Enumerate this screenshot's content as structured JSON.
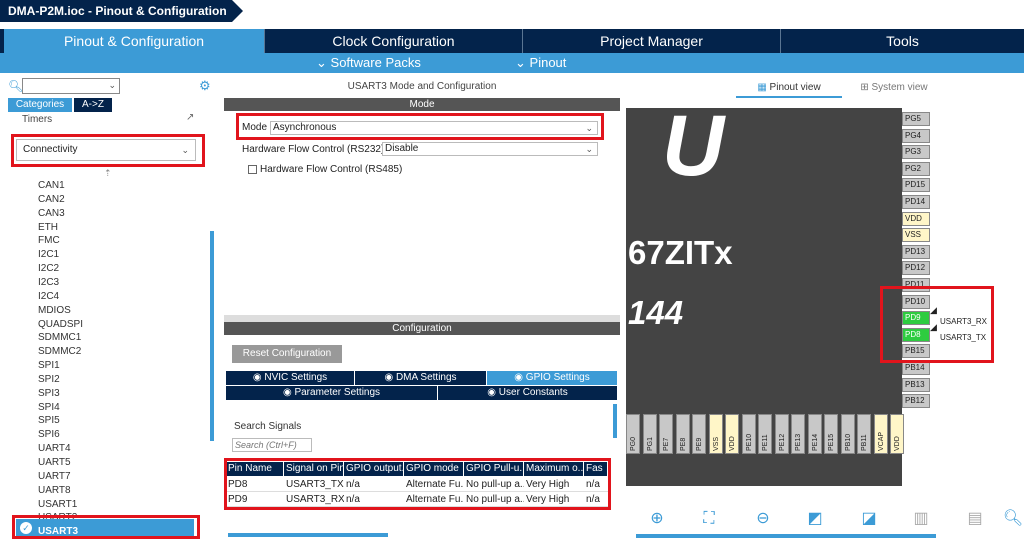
{
  "title": "DMA-P2M.ioc - Pinout & Configuration",
  "tabs": [
    "Pinout & Configuration",
    "Clock Configuration",
    "Project Manager",
    "Tools"
  ],
  "subtabs": [
    "Software Packs",
    "Pinout"
  ],
  "left": {
    "categories_tab": "Categories",
    "az_tab": "A->Z",
    "timers": "Timers",
    "connectivity": "Connectivity",
    "items": [
      "CAN1",
      "CAN2",
      "CAN3",
      "ETH",
      "FMC",
      "I2C1",
      "I2C2",
      "I2C3",
      "I2C4",
      "MDIOS",
      "QUADSPI",
      "SDMMC1",
      "SDMMC2",
      "SPI1",
      "SPI2",
      "SPI3",
      "SPI4",
      "SPI5",
      "SPI6",
      "UART4",
      "UART5",
      "UART7",
      "UART8",
      "USART1",
      "USART2",
      "USART3"
    ]
  },
  "middle": {
    "header": "USART3 Mode and Configuration",
    "mode_title": "Mode",
    "mode_label": "Mode",
    "mode_value": "Asynchronous",
    "hw_flow_label": "Hardware Flow Control (RS232)",
    "hw_flow_value": "Disable",
    "rs485_label": "Hardware Flow Control (RS485)",
    "config_title": "Configuration",
    "reset_button": "Reset Configuration",
    "tabs_row1": [
      "NVIC Settings",
      "DMA Settings",
      "GPIO Settings"
    ],
    "tabs_row2": [
      "Parameter Settings",
      "User Constants"
    ],
    "search_label": "Search Signals",
    "search_placeholder": "Search (Ctrl+F)",
    "columns": [
      "Pin Name",
      "Signal on Pin",
      "GPIO output...",
      "GPIO mode",
      "GPIO Pull-u...",
      "Maximum o...",
      "Fas"
    ],
    "rows": [
      [
        "PD8",
        "USART3_TX",
        "n/a",
        "Alternate Fu...",
        "No pull-up a...",
        "Very High",
        "n/a"
      ],
      [
        "PD9",
        "USART3_RX",
        "n/a",
        "Alternate Fu...",
        "No pull-up a...",
        "Very High",
        "n/a"
      ]
    ]
  },
  "right": {
    "pinout_view": "Pinout view",
    "system_view": "System view",
    "chip_text1": "67ZITx",
    "chip_text2": "144",
    "chip_glyph": "U",
    "right_pins": [
      "PG5",
      "PG4",
      "PG3",
      "PG2",
      "PD15",
      "PD14",
      "VDD",
      "VSS",
      "PD13",
      "PD12",
      "PD11",
      "PD10",
      "PD9",
      "PD8",
      "PB15",
      "PB14",
      "PB13",
      "PB12"
    ],
    "bottom_pins": [
      "PG0",
      "PG1",
      "PE7",
      "PE8",
      "PE9",
      "VSS",
      "VDD",
      "PE10",
      "PE11",
      "PE12",
      "PE13",
      "PE14",
      "PE15",
      "PB10",
      "PB11",
      "VCAP",
      "VDD"
    ],
    "usart_rx": "USART3_RX",
    "usart_tx": "USART3_TX"
  },
  "colors": {
    "navy": "#03234b",
    "accent": "#3c9bd6",
    "highlight": "#e1141c",
    "pin_green": "#2ecc40"
  }
}
